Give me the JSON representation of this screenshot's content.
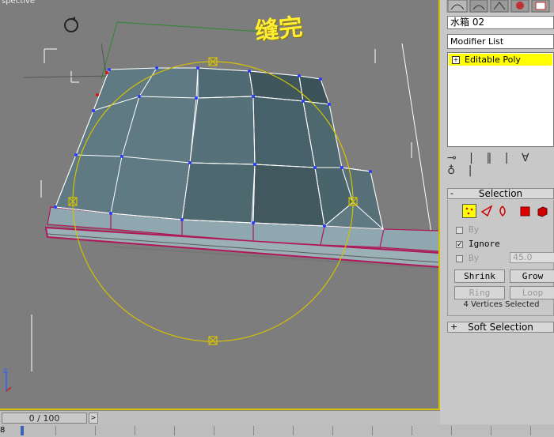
{
  "viewport": {
    "label": "spective",
    "annotation_text": "缝完",
    "axis_label": "z"
  },
  "timeline": {
    "frame_display": "0 / 100",
    "next_button": ">",
    "track_start_label": "8"
  },
  "panel": {
    "object_name": "水箱    02",
    "modifier_list_label": "Modifier List",
    "stack_item_plus": "+",
    "stack_item_label": "Editable Poly",
    "stack_tools": "⊸ | ∥ | ∀ ♁ |",
    "selection_rollout": {
      "toggle": "-",
      "title": "Selection",
      "by_vertex_label": "By",
      "ignore_backfacing_label": "Ignore",
      "ignore_check": "✓",
      "by_angle_label": "By",
      "angle_value": "45.0",
      "shrink_label": "Shrink",
      "grow_label": "Grow",
      "ring_label": "Ring",
      "loop_label": "Loop",
      "status": "4 Vertices Selected"
    },
    "soft_selection_rollout": {
      "toggle": "+",
      "title": "Soft Selection"
    }
  },
  "colors": {
    "viewport_bg": "#7d7d7d",
    "active_border": "#d4c100",
    "selected_stack_item": "#ffff00",
    "mesh_edge": "#b0185a",
    "gizmo_yellow": "#d4c100",
    "vertex_blue": "#2a3cff"
  }
}
